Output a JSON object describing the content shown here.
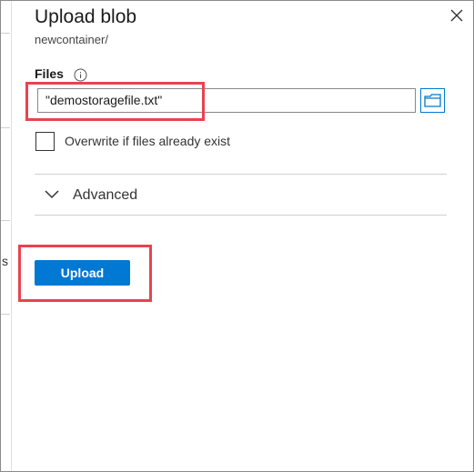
{
  "panel": {
    "title": "Upload blob",
    "subtitle": "newcontainer/"
  },
  "files": {
    "label": "Files",
    "value": "\"demostoragefile.txt\""
  },
  "overwrite": {
    "label": "Overwrite if files already exist",
    "checked": false
  },
  "advanced": {
    "label": "Advanced"
  },
  "actions": {
    "upload_label": "Upload"
  },
  "background": {
    "partial_text": "s"
  },
  "colors": {
    "accent": "#0078d4",
    "highlight": "#e8434f"
  },
  "icons": [
    "close-icon",
    "info-icon",
    "folder-icon",
    "chevron-down-icon"
  ]
}
